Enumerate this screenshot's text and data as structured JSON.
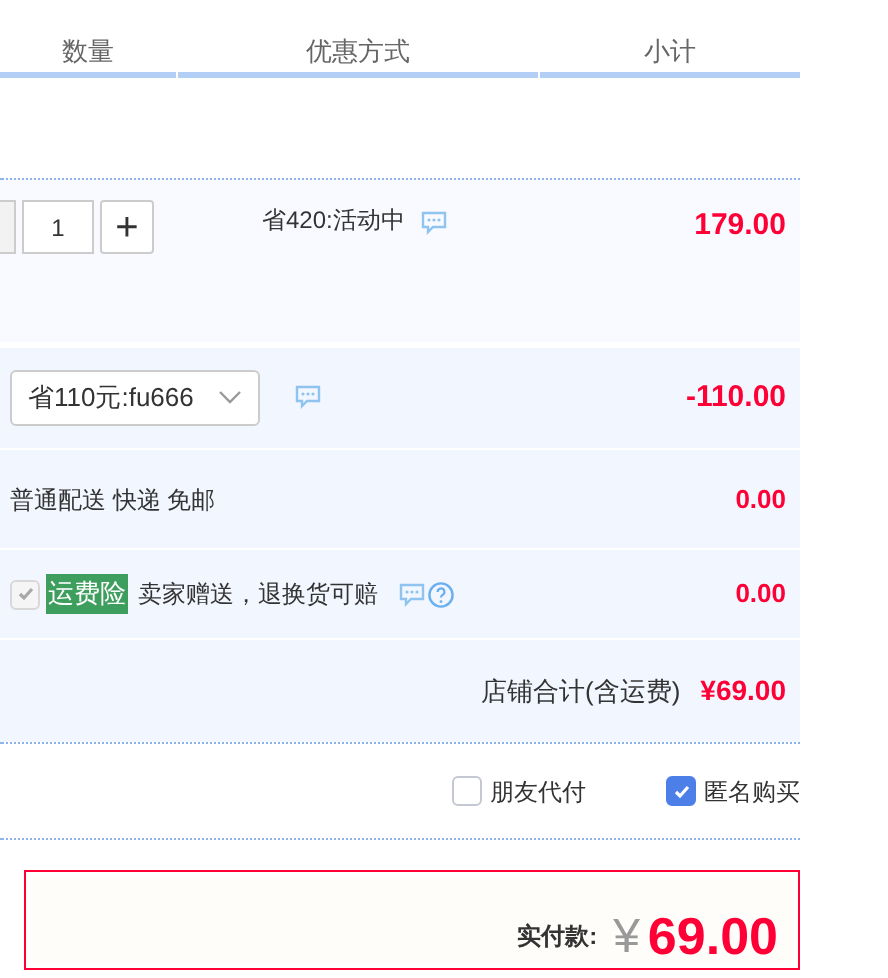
{
  "columns": [
    "数量",
    "优惠方式",
    "小计"
  ],
  "item": {
    "quantity": "1",
    "plus": "+",
    "offer": "省420:活动中",
    "subtotal": "179.00"
  },
  "coupon": {
    "value": "省110元:fu666",
    "amount": "-110.00"
  },
  "shipping": {
    "text": "普通配送 快递 免邮",
    "amount": "0.00"
  },
  "insurance": {
    "checked": true,
    "disabled": true,
    "tag": "运费险",
    "text": "卖家赠送，退换货可赔",
    "amount": "0.00"
  },
  "store_total": {
    "label": "店铺合计(含运费)",
    "amount": "¥69.00"
  },
  "options": [
    {
      "label": "朋友代付",
      "checked": false
    },
    {
      "label": "匿名购买",
      "checked": true
    }
  ],
  "payment": {
    "label": "实付款:",
    "currency": "¥",
    "amount": "69.00"
  }
}
